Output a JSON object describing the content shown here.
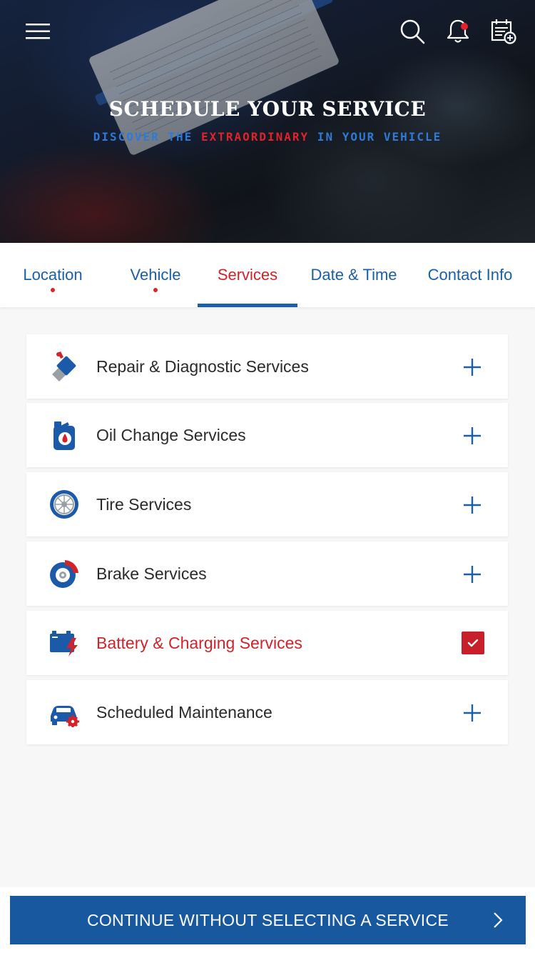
{
  "hero": {
    "title": "SCHEDULE YOUR SERVICE",
    "subtitle_part1": "DISCOVER THE ",
    "subtitle_accent": "EXTRAORDINARY",
    "subtitle_part2": " IN YOUR VEHICLE"
  },
  "top_icons": [
    "menu-icon",
    "search-icon",
    "bell-icon",
    "calendar-add-icon"
  ],
  "tabs": [
    {
      "label": "Location",
      "completed": true
    },
    {
      "label": "Vehicle",
      "completed": true
    },
    {
      "label": "Services",
      "active": true
    },
    {
      "label": "Date & Time"
    },
    {
      "label": "Contact Info"
    }
  ],
  "services": [
    {
      "label": "Repair & Diagnostic Services",
      "icon": "wrench-icon",
      "selected": false
    },
    {
      "label": "Oil Change Services",
      "icon": "oil-can-icon",
      "selected": false
    },
    {
      "label": "Tire Services",
      "icon": "tire-icon",
      "selected": false
    },
    {
      "label": "Brake Services",
      "icon": "brake-icon",
      "selected": false
    },
    {
      "label": "Battery & Charging Services",
      "icon": "battery-icon",
      "selected": true
    },
    {
      "label": "Scheduled Maintenance",
      "icon": "car-gear-icon",
      "selected": false
    }
  ],
  "footer": {
    "continue_label": "CONTINUE WITHOUT SELECTING A SERVICE"
  },
  "colors": {
    "brand_blue": "#17589f",
    "accent_red": "#d3232a",
    "background": "#f7f7f7"
  }
}
